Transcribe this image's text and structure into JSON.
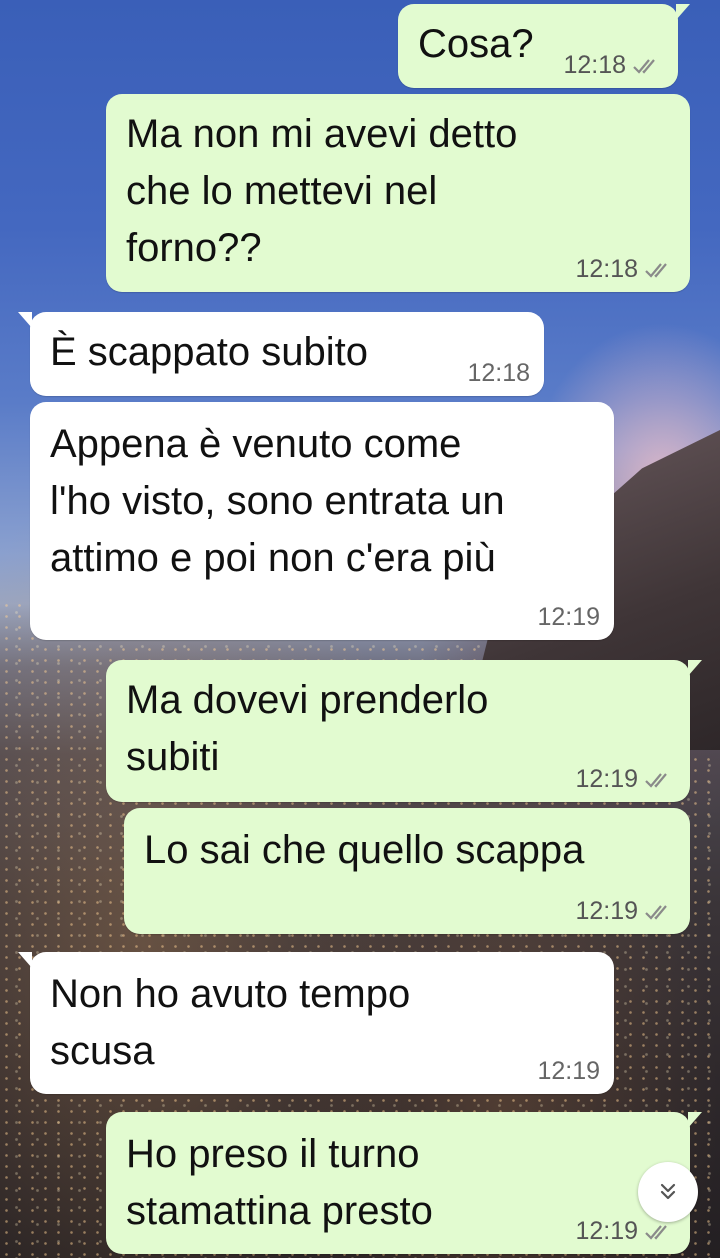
{
  "messages": [
    {
      "text": "Cosa?",
      "time": "12:18",
      "dir": "out"
    },
    {
      "text": "Ma non mi avevi detto\nche lo mettevi nel\nforno??",
      "time": "12:18",
      "dir": "out"
    },
    {
      "text": "È scappato subito",
      "time": "12:18",
      "dir": "in"
    },
    {
      "text": "Appena è venuto come\nl'ho visto, sono entrata un\nattimo e poi non c'era più",
      "time": "12:19",
      "dir": "in"
    },
    {
      "text": "Ma dovevi prenderlo\nsubiti",
      "time": "12:19",
      "dir": "out"
    },
    {
      "text": "Lo sai che quello scappa",
      "time": "12:19",
      "dir": "out"
    },
    {
      "text": "Non ho avuto tempo\nscusa",
      "time": "12:19",
      "dir": "in"
    },
    {
      "text": "Ho preso il turno\nstamattina presto",
      "time": "12:19",
      "dir": "out"
    }
  ],
  "icons": {
    "read_receipt": "double-check-icon",
    "scroll_down": "double-chevron-down-icon"
  },
  "colors": {
    "outgoing_bubble": "#e2fbd0",
    "incoming_bubble": "#ffffff",
    "tick_color": "#8a8a8a"
  }
}
